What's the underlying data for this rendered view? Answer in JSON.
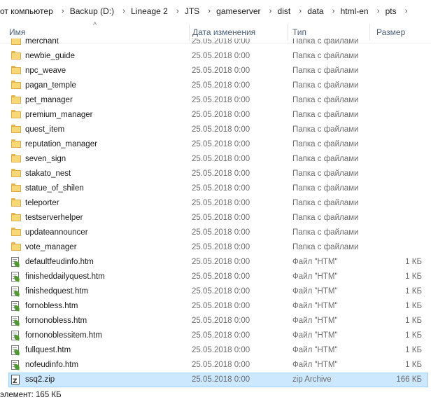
{
  "breadcrumb": [
    "от компьютер",
    "Backup (D:)",
    "Lineage 2",
    "JTS",
    "gameserver",
    "dist",
    "data",
    "html-en",
    "pts"
  ],
  "columns": {
    "name": "Имя",
    "date": "Дата изменения",
    "type": "Тип",
    "size": "Размер"
  },
  "rows": [
    {
      "name": "merchant",
      "date": "25.05.2018 0:00",
      "type": "Папка с файлами",
      "size": "",
      "icon": "folder-icon"
    },
    {
      "name": "newbie_guide",
      "date": "25.05.2018 0:00",
      "type": "Папка с файлами",
      "size": "",
      "icon": "folder-icon"
    },
    {
      "name": "npc_weave",
      "date": "25.05.2018 0:00",
      "type": "Папка с файлами",
      "size": "",
      "icon": "folder-icon"
    },
    {
      "name": "pagan_temple",
      "date": "25.05.2018 0:00",
      "type": "Папка с файлами",
      "size": "",
      "icon": "folder-icon"
    },
    {
      "name": "pet_manager",
      "date": "25.05.2018 0:00",
      "type": "Папка с файлами",
      "size": "",
      "icon": "folder-icon"
    },
    {
      "name": "premium_manager",
      "date": "25.05.2018 0:00",
      "type": "Папка с файлами",
      "size": "",
      "icon": "folder-icon"
    },
    {
      "name": "quest_item",
      "date": "25.05.2018 0:00",
      "type": "Папка с файлами",
      "size": "",
      "icon": "folder-icon"
    },
    {
      "name": "reputation_manager",
      "date": "25.05.2018 0:00",
      "type": "Папка с файлами",
      "size": "",
      "icon": "folder-icon"
    },
    {
      "name": "seven_sign",
      "date": "25.05.2018 0:00",
      "type": "Папка с файлами",
      "size": "",
      "icon": "folder-icon"
    },
    {
      "name": "stakato_nest",
      "date": "25.05.2018 0:00",
      "type": "Папка с файлами",
      "size": "",
      "icon": "folder-icon"
    },
    {
      "name": "statue_of_shilen",
      "date": "25.05.2018 0:00",
      "type": "Папка с файлами",
      "size": "",
      "icon": "folder-icon"
    },
    {
      "name": "teleporter",
      "date": "25.05.2018 0:00",
      "type": "Папка с файлами",
      "size": "",
      "icon": "folder-icon"
    },
    {
      "name": "testserverhelper",
      "date": "25.05.2018 0:00",
      "type": "Папка с файлами",
      "size": "",
      "icon": "folder-icon"
    },
    {
      "name": "updateannouncer",
      "date": "25.05.2018 0:00",
      "type": "Папка с файлами",
      "size": "",
      "icon": "folder-icon"
    },
    {
      "name": "vote_manager",
      "date": "25.05.2018 0:00",
      "type": "Папка с файлами",
      "size": "",
      "icon": "folder-icon"
    },
    {
      "name": "defaultfeudinfo.htm",
      "date": "25.05.2018 0:00",
      "type": "Файл \"HTM\"",
      "size": "1 КБ",
      "icon": "htm-file-icon"
    },
    {
      "name": "finisheddailyquest.htm",
      "date": "25.05.2018 0:00",
      "type": "Файл \"HTM\"",
      "size": "1 КБ",
      "icon": "htm-file-icon"
    },
    {
      "name": "finishedquest.htm",
      "date": "25.05.2018 0:00",
      "type": "Файл \"HTM\"",
      "size": "1 КБ",
      "icon": "htm-file-icon"
    },
    {
      "name": "fornobless.htm",
      "date": "25.05.2018 0:00",
      "type": "Файл \"HTM\"",
      "size": "1 КБ",
      "icon": "htm-file-icon"
    },
    {
      "name": "fornonobless.htm",
      "date": "25.05.2018 0:00",
      "type": "Файл \"HTM\"",
      "size": "1 КБ",
      "icon": "htm-file-icon"
    },
    {
      "name": "fornonoblessitem.htm",
      "date": "25.05.2018 0:00",
      "type": "Файл \"HTM\"",
      "size": "1 КБ",
      "icon": "htm-file-icon"
    },
    {
      "name": "fullquest.htm",
      "date": "25.05.2018 0:00",
      "type": "Файл \"HTM\"",
      "size": "1 КБ",
      "icon": "htm-file-icon"
    },
    {
      "name": "nofeudinfo.htm",
      "date": "25.05.2018 0:00",
      "type": "Файл \"HTM\"",
      "size": "1 КБ",
      "icon": "htm-file-icon"
    },
    {
      "name": "ssq2.zip",
      "date": "25.05.2018 0:00",
      "type": "zip Archive",
      "size": "166 КБ",
      "icon": "zip-file-icon",
      "selected": true
    }
  ],
  "status": {
    "text": "элемент: 165 КБ"
  },
  "colors": {
    "selected_bg": "#cce8ff",
    "selected_border": "#99d1ff",
    "header_text": "#4c607a"
  }
}
